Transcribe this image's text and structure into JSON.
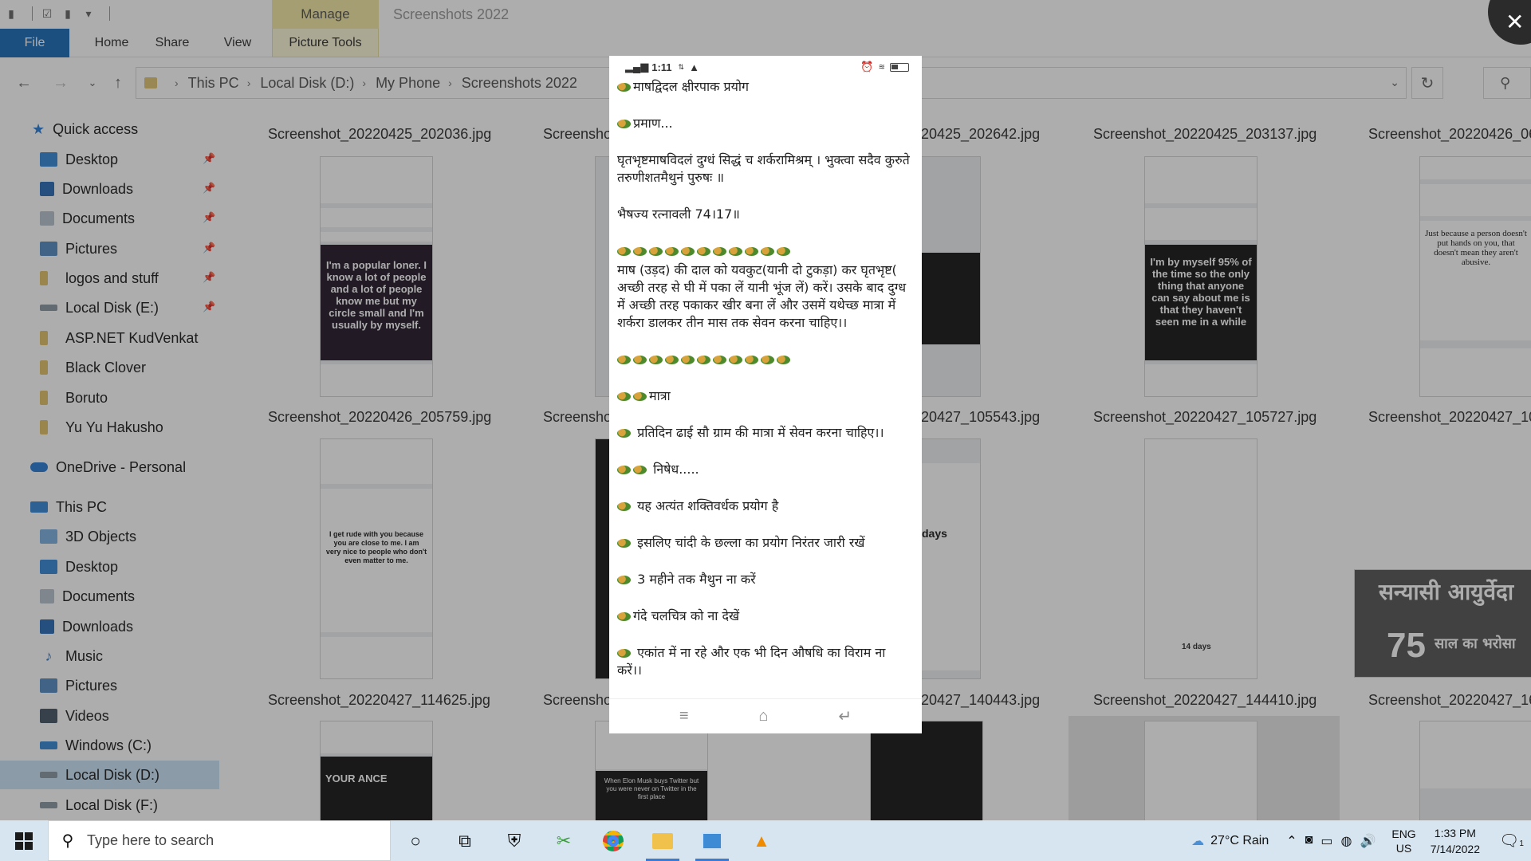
{
  "explorer": {
    "quick_access_icons": [
      "folder-icon",
      "checkbox-icon",
      "folder-icon",
      "dropdown-icon"
    ],
    "manage_tab": "Manage",
    "window_title": "Screenshots 2022",
    "ribbon_tabs": [
      "File",
      "Home",
      "Share",
      "View",
      "Picture Tools"
    ],
    "breadcrumbs": [
      "This PC",
      "Local Disk (D:)",
      "My Phone",
      "Screenshots 2022"
    ],
    "sidebar": [
      {
        "label": "Quick access",
        "icon": "star-icon",
        "pinned": false
      },
      {
        "label": "Desktop",
        "icon": "desktop-icon",
        "pinned": true
      },
      {
        "label": "Downloads",
        "icon": "download-icon",
        "pinned": true
      },
      {
        "label": "Documents",
        "icon": "documents-icon",
        "pinned": true
      },
      {
        "label": "Pictures",
        "icon": "pictures-icon",
        "pinned": true
      },
      {
        "label": "logos and stuff",
        "icon": "folder-icon",
        "pinned": true
      },
      {
        "label": "Local Disk (E:)",
        "icon": "drive-icon",
        "pinned": true
      },
      {
        "label": "ASP.NET KudVenkat",
        "icon": "folder-icon",
        "pinned": false
      },
      {
        "label": "Black Clover",
        "icon": "folder-icon",
        "pinned": false
      },
      {
        "label": "Boruto",
        "icon": "folder-icon",
        "pinned": false
      },
      {
        "label": "Yu Yu Hakusho",
        "icon": "folder-icon",
        "pinned": false
      },
      {
        "label": "OneDrive - Personal",
        "icon": "cloud-icon",
        "pinned": false
      },
      {
        "label": "This PC",
        "icon": "pc-icon",
        "pinned": false
      },
      {
        "label": "3D Objects",
        "icon": "cube-icon",
        "pinned": false
      },
      {
        "label": "Desktop",
        "icon": "desktop-icon",
        "pinned": false
      },
      {
        "label": "Documents",
        "icon": "documents-icon",
        "pinned": false
      },
      {
        "label": "Downloads",
        "icon": "download-icon",
        "pinned": false
      },
      {
        "label": "Music",
        "icon": "music-icon",
        "pinned": false
      },
      {
        "label": "Pictures",
        "icon": "pictures-icon",
        "pinned": false
      },
      {
        "label": "Videos",
        "icon": "videos-icon",
        "pinned": false
      },
      {
        "label": "Windows (C:)",
        "icon": "drive-icon",
        "pinned": false
      },
      {
        "label": "Local Disk (D:)",
        "icon": "drive-icon",
        "pinned": false
      },
      {
        "label": "Local Disk (F:)",
        "icon": "drive-icon",
        "pinned": false
      }
    ],
    "selected_sidebar_item": "Local Disk (D:)",
    "files": [
      "Screenshot_20220425_202036.jpg",
      "Screensho",
      "20425_202642.jpg",
      "Screenshot_20220425_203137.jpg",
      "Screenshot_20220426_06",
      "Screenshot_20220426_205759.jpg",
      "Screensho",
      "20427_105543.jpg",
      "Screenshot_20220427_105727.jpg",
      "Screenshot_20220427_10",
      "Screenshot_20220427_114625.jpg",
      "Screensho",
      "20427_140443.jpg",
      "Screenshot_20220427_144410.jpg",
      "Screenshot_20220427_16"
    ],
    "thumb_texts": {
      "t1": "I'm a popular loner. I know a lot of people and a lot of people know me but my circle small and I'm usually by myself.",
      "t2": "I'm by myself 95% of the time so the only thing that anyone can say about me is that they haven't seen me in a while",
      "t3": "Just because a person doesn't put hands on you, that doesn't mean they aren't abusive.",
      "t4": "I get rude with you because you are close to me. I am very nice to people who don't even matter to me.",
      "t5": "14 days",
      "t6": "days",
      "t7": "YOUR ANCE",
      "t8": "When Elon Musk buys Twitter but you were never on Twitter in the first place",
      "t9": "सन्यासी आयुर्वेदा",
      "t10": "75",
      "t11": "साल का भरोसा"
    }
  },
  "viewer": {
    "close_label": "✕",
    "status_time": "1:11",
    "lines": [
      "माषद्विदल क्षीरपाक प्रयोग",
      "प्रमाण...",
      "घृतभृष्टमाषविदलं दुग्धं सिद्धं च शर्करामिश्रम् । भुक्त्वा सदैव कुरुते तरुणीशतमैथुनं पुरुषः ॥",
      " भैषज्य रत्नावली 74।17॥",
      "",
      " माष (उड़द) की दाल को यवकुट(यानी दो टुकड़ा) कर घृतभृष्ट( अच्छी तरह से घी में पका लें यानी भूंज लें) करें। उसके बाद दुग्ध में अच्छी तरह पकाकर खीर बना लें और उसमें यथेच्छ मात्रा में शर्करा डालकर तीन मास तक सेवन करना चाहिए।।",
      "",
      "मात्रा",
      " प्रतिदिन ढाई सौ ग्राम की मात्रा में सेवन करना चाहिए।।",
      " निषेध.....",
      " यह अत्यंत शक्तिवर्धक प्रयोग है",
      " इसलिए चांदी के छल्ला का प्रयोग निरंतर जारी रखें",
      " 3 महीने तक मैथुन ना करें",
      "गंदे चलचित्र को ना देखें",
      " एकांत में ना रहे और एक भी दिन औषधि का विराम ना करें।।"
    ]
  },
  "taskbar": {
    "search_placeholder": "Type here to search",
    "weather": "27°C  Rain",
    "lang_1": "ENG",
    "lang_2": "US",
    "time": "1:33 PM",
    "date": "7/14/2022",
    "notification_count": "1"
  }
}
